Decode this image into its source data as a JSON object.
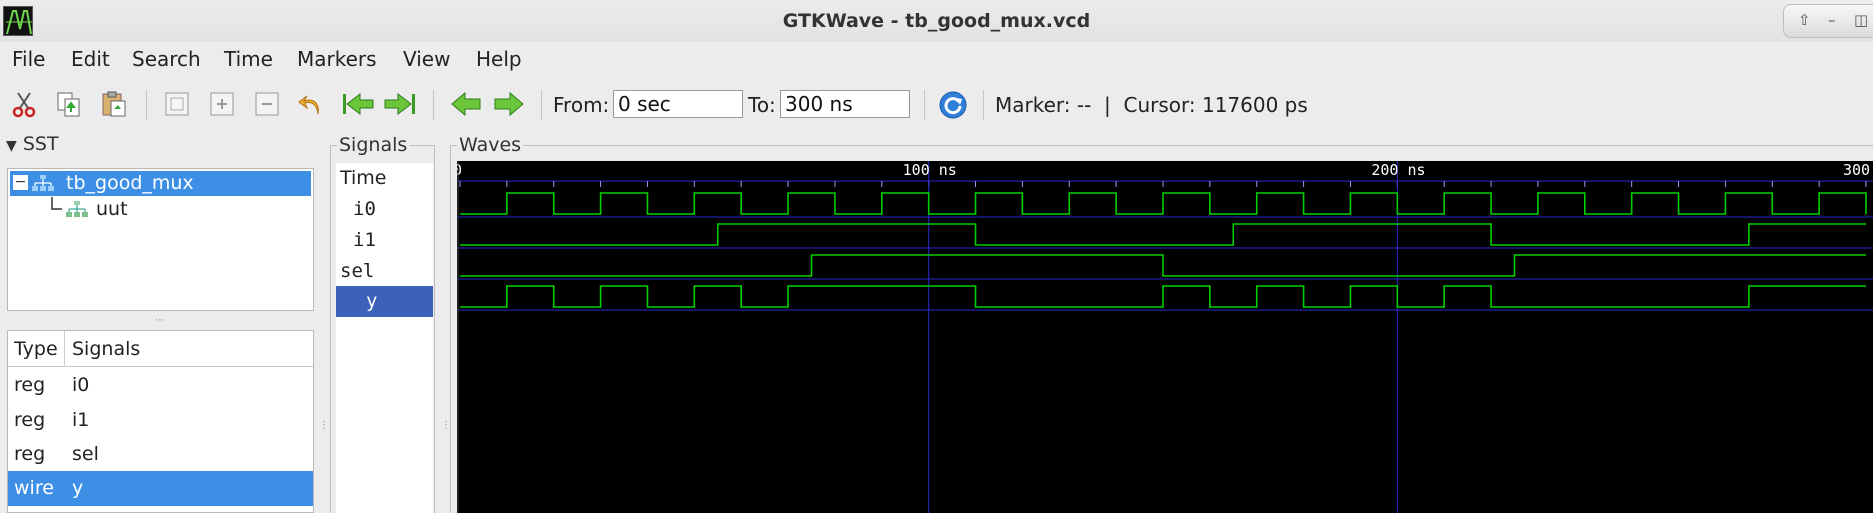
{
  "window": {
    "title": "GTKWave - tb_good_mux.vcd"
  },
  "menu": [
    "File",
    "Edit",
    "Search",
    "Time",
    "Markers",
    "View",
    "Help"
  ],
  "toolbar": {
    "icons": [
      "cut-icon",
      "copy-icon",
      "paste-icon",
      "zoom-fit-icon",
      "zoom-in-icon",
      "zoom-out-icon",
      "undo-icon",
      "zoom-start-icon",
      "zoom-end-icon",
      "prev-edge-icon",
      "next-edge-icon",
      "reload-icon"
    ],
    "from_label": "From:",
    "from_value": "0 sec",
    "to_label": "To:",
    "to_value": "300 ns",
    "marker_text": "Marker: --  |  Cursor: 117600 ps"
  },
  "sst": {
    "header": "SST",
    "tree": [
      {
        "label": "tb_good_mux",
        "selected": true
      },
      {
        "label": "uut",
        "selected": false
      }
    ],
    "table": {
      "headers": [
        "Type",
        "Signals"
      ],
      "rows": [
        {
          "type": "reg",
          "name": "i0",
          "selected": false
        },
        {
          "type": "reg",
          "name": "i1",
          "selected": false
        },
        {
          "type": "reg",
          "name": "sel",
          "selected": false
        },
        {
          "type": "wire",
          "name": "y",
          "selected": true
        }
      ]
    }
  },
  "signals_panel": {
    "title": "Signals",
    "time_label": "Time",
    "signals": [
      "i0",
      "i1",
      "sel",
      "y"
    ],
    "selected": "y"
  },
  "waves": {
    "title": "Waves",
    "ruler": {
      "start_label": "0",
      "labels": [
        "100 ns",
        "200 ns",
        "300"
      ]
    },
    "time_range_ns": [
      0,
      300
    ],
    "colors": {
      "background": "#000000",
      "wave": "#00d000",
      "grid": "#2a2ad0",
      "ruler_text": "#ffffff"
    },
    "signals": [
      {
        "name": "i0",
        "initial": 0,
        "toggles_ns": [
          10,
          20,
          30,
          40,
          50,
          60,
          70,
          80,
          90,
          100,
          110,
          120,
          130,
          140,
          150,
          160,
          170,
          180,
          190,
          200,
          210,
          220,
          230,
          240,
          250,
          260,
          270,
          280,
          290,
          300
        ]
      },
      {
        "name": "i1",
        "initial": 0,
        "toggles_ns": [
          55,
          110,
          165,
          220,
          275
        ]
      },
      {
        "name": "sel",
        "initial": 0,
        "toggles_ns": [
          75,
          150,
          225
        ]
      },
      {
        "name": "y",
        "initial": 0,
        "toggles_ns": [
          10,
          20,
          30,
          40,
          50,
          60,
          70,
          110,
          150,
          160,
          170,
          180,
          190,
          200,
          210,
          220,
          275
        ]
      }
    ]
  }
}
